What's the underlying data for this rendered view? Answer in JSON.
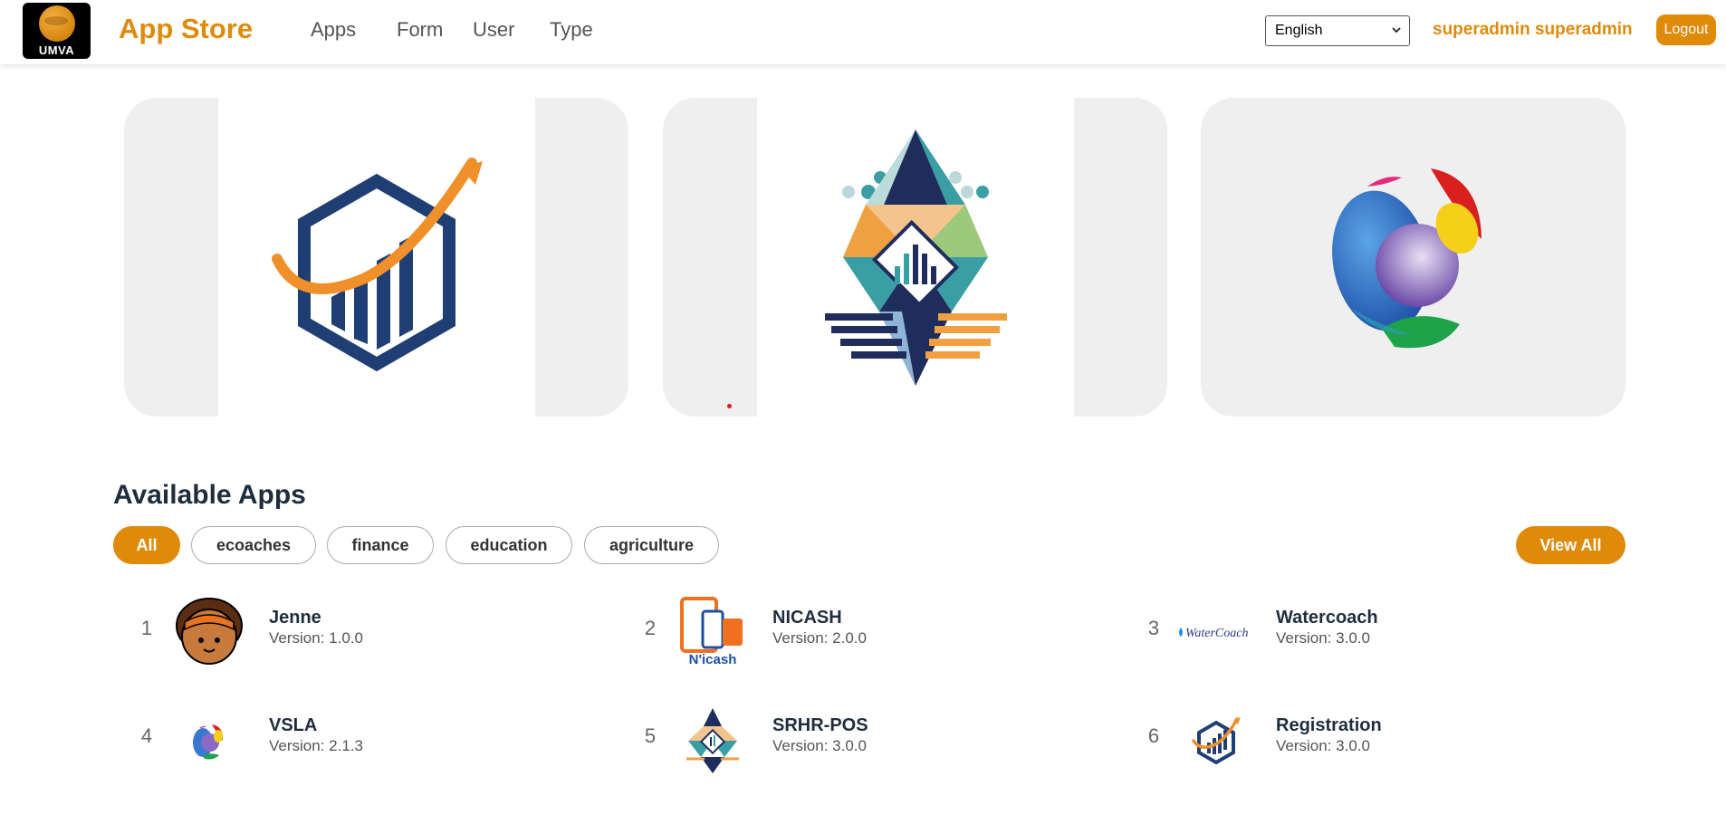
{
  "header": {
    "logo_text": "UMVA",
    "title": "App Store",
    "nav": [
      "Apps",
      "Form",
      "User",
      "Type"
    ],
    "language": "English",
    "user_name": "superadmin superadmin",
    "logout_label": "Logout"
  },
  "carousel": {
    "slides": [
      "registration-logo",
      "srhr-pos-logo",
      "vsla-logo"
    ],
    "active_indicator_color": "#d42020"
  },
  "available_apps": {
    "title": "Available Apps",
    "filters": [
      "All",
      "ecoaches",
      "finance",
      "education",
      "agriculture"
    ],
    "active_filter": "All",
    "view_all_label": "View All",
    "apps": [
      {
        "num": "1",
        "name": "Jenne",
        "version": "Version: 1.0.0",
        "icon": "jenne-avatar-icon"
      },
      {
        "num": "2",
        "name": "NICASH",
        "version": "Version: 2.0.0",
        "icon": "nicash-icon",
        "icon_text": "N'icash"
      },
      {
        "num": "3",
        "name": "Watercoach",
        "version": "Version: 3.0.0",
        "icon": "watercoach-icon",
        "icon_text": "WaterCoach"
      },
      {
        "num": "4",
        "name": "VSLA",
        "version": "Version: 2.1.3",
        "icon": "vsla-icon"
      },
      {
        "num": "5",
        "name": "SRHR-POS",
        "version": "Version: 3.0.0",
        "icon": "srhr-pos-icon"
      },
      {
        "num": "6",
        "name": "Registration",
        "version": "Version: 3.0.0",
        "icon": "registration-icon"
      }
    ]
  },
  "colors": {
    "accent": "#e08a0a",
    "heading": "#1f2d3d",
    "card_bg": "#efefef"
  }
}
